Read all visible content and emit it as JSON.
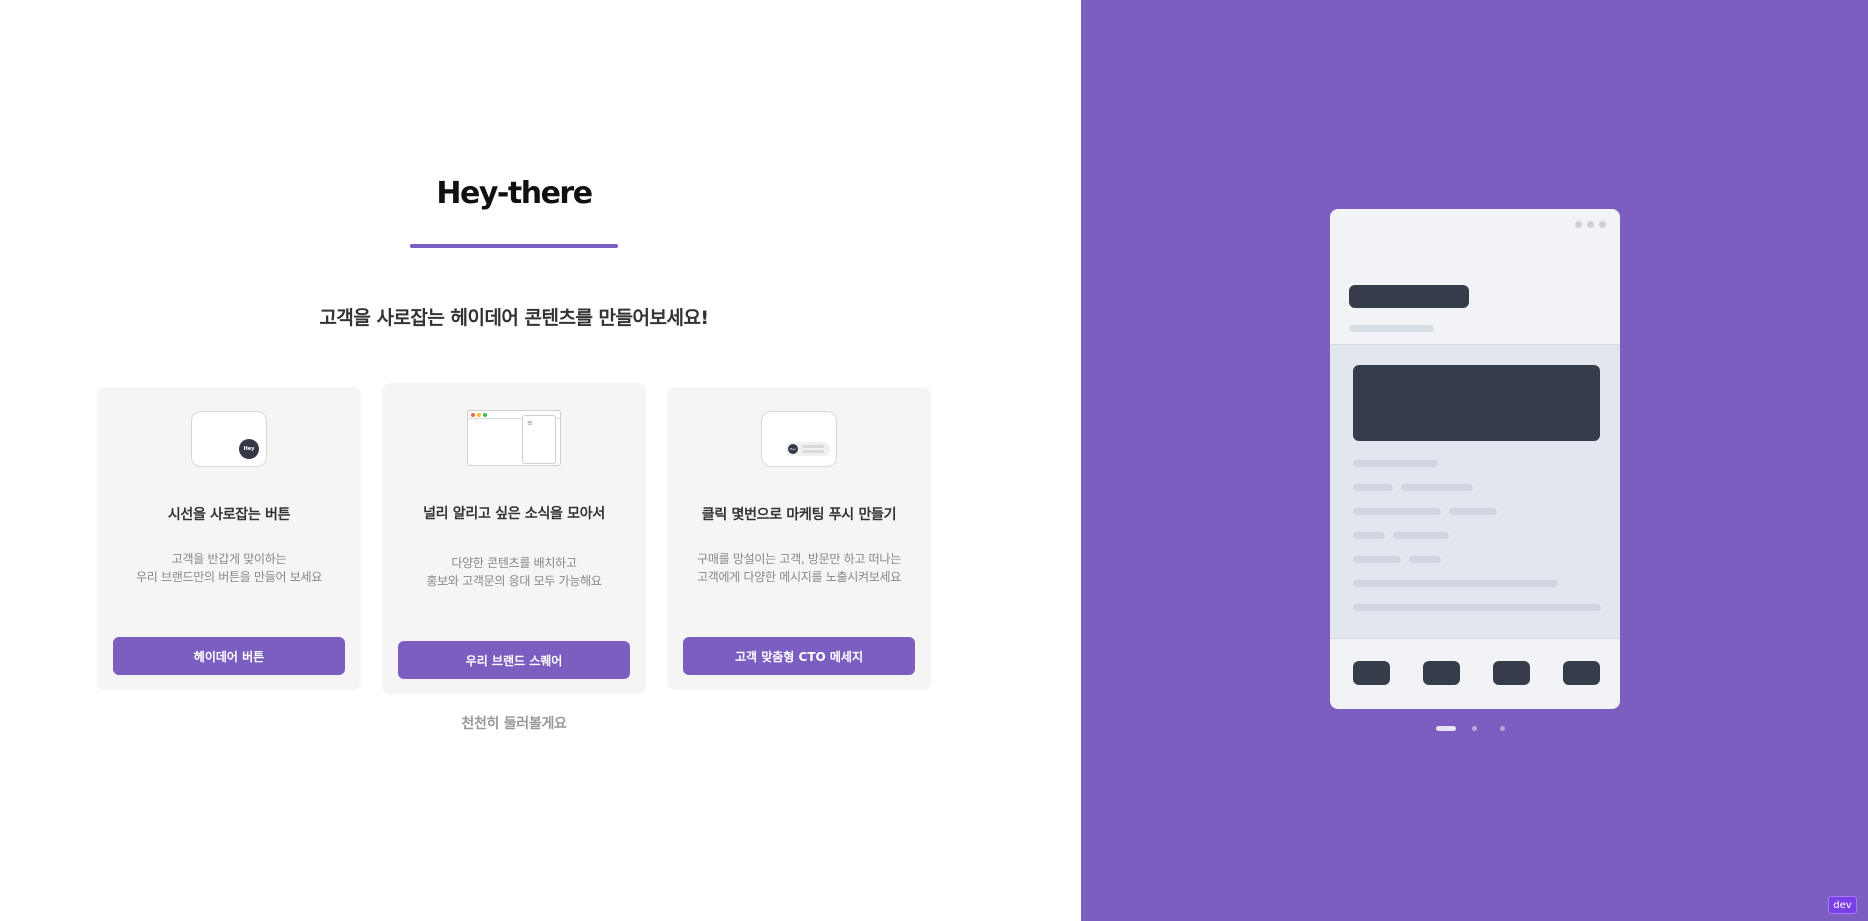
{
  "brand": {
    "logo_text": "Hey-there",
    "accent_color": "#7b5ec0"
  },
  "headline": "고객을 사로잡는 헤이데어 콘텐츠를 만들어보세요!",
  "cards": [
    {
      "title": "시선을 사로잡는 버튼",
      "desc_line1": "고객을 반갑게 맞이하는",
      "desc_line2": "우리 브랜드만의 버튼을 만들어 보세요",
      "button_label": "헤이데어 버튼",
      "illustration_badge": "Hey",
      "illustration_icon": "floating-button-icon"
    },
    {
      "title": "널리 알리고 싶은 소식을 모아서",
      "desc_line1": "다양한 콘텐츠를 배치하고",
      "desc_line2": "홍보와 고객문의 응대 모두 가능해요",
      "button_label": "우리 브랜드 스퀘어",
      "illustration_icon": "browser-panel-icon"
    },
    {
      "title": "클릭 몇번으로 마케팅 푸시 만들기",
      "desc_line1": "구매를 망설이는 고객, 방문만 하고 떠나는",
      "desc_line2": "고객에게 다양한 메시지를 노출시켜보세요",
      "button_label": "고객 맞춤형 CTO 메세지",
      "illustration_badge": "Hey",
      "illustration_icon": "push-message-icon"
    }
  ],
  "browse_link": "천천히 둘러볼게요",
  "preview": {
    "background_color": "#7b5ec0",
    "carousel_pages": 3,
    "carousel_active": 1
  },
  "dev_badge": "dev"
}
